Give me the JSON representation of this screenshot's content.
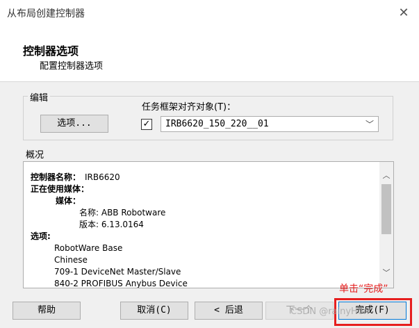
{
  "window": {
    "title": "从布局创建控制器",
    "close_glyph": "✕"
  },
  "header": {
    "title": "控制器选项",
    "subtitle": "配置控制器选项"
  },
  "edit_group": {
    "legend": "编辑",
    "options_button": "选项...",
    "task_frame_label": "任务框架对齐对象(T)：",
    "task_frame_checked": true,
    "task_frame_value": "IRB6620_150_220__01"
  },
  "overview": {
    "label": "概况",
    "lines": [
      {
        "label": "控制器名称：",
        "value": "IRB6620"
      },
      {
        "label": "正在使用媒体：",
        "value": ""
      },
      {
        "label": "媒体：",
        "value": ""
      },
      {
        "label": "",
        "value": "名称: ABB Robotware"
      },
      {
        "label": "",
        "value": "版本: 6.13.0164"
      },
      {
        "label": "选项:",
        "value": ""
      },
      {
        "label": "",
        "value": "RobotWare Base"
      },
      {
        "label": "",
        "value": "Chinese"
      },
      {
        "label": "",
        "value": "709-1 DeviceNet Master/Slave"
      },
      {
        "label": "",
        "value": "840-2 PROFIBUS Anybus Device"
      }
    ]
  },
  "buttons": {
    "help": "帮助",
    "cancel": "取消(C)",
    "back": "< 后退",
    "next": "下一个",
    "finish": "完成(F)"
  },
  "annotation": {
    "text": "单击“完成”",
    "color": "#e61e1e"
  },
  "watermark": "CSDN @rainyHon"
}
